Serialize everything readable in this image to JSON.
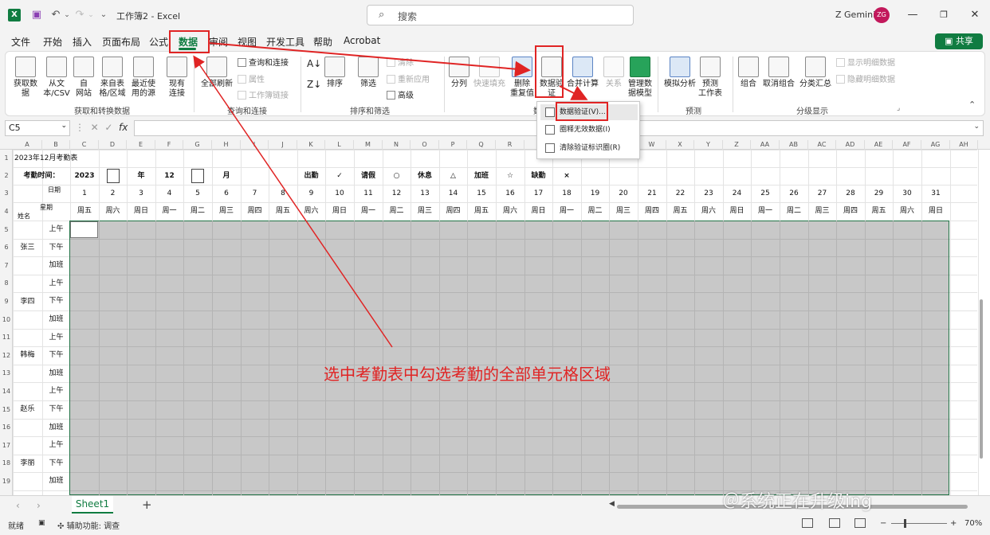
{
  "window": {
    "title": "工作簿2 - Excel",
    "search_placeholder": "搜索",
    "user_name": "Z Gemini",
    "avatar_initials": "ZG"
  },
  "menu": {
    "tabs": [
      "文件",
      "开始",
      "插入",
      "页面布局",
      "公式",
      "数据",
      "审阅",
      "视图",
      "开发工具",
      "帮助",
      "Acrobat"
    ],
    "active": "数据",
    "share": "共享"
  },
  "ribbon": {
    "get_data": "获取数\n据",
    "from_text_csv": "从文\n本/CSV",
    "from_web": "自\n网站",
    "from_table": "来自表\n格/区域",
    "recent_sources": "最近使\n用的源",
    "existing_connections": "现有\n连接",
    "group_get_transform": "获取和转换数据",
    "refresh_all": "全部刷新",
    "queries_connections": "查询和连接",
    "properties": "属性",
    "workbook_links": "工作簿链接",
    "group_queries": "查询和连接",
    "sort": "排序",
    "filter": "筛选",
    "clear": "清除",
    "reapply": "重新应用",
    "advanced": "高级",
    "group_sort_filter": "排序和筛选",
    "text_to_columns": "分列",
    "flash_fill": "快速填充",
    "remove_duplicates": "删除\n重复值",
    "data_validation": "数据验\n证",
    "consolidate": "合并计算",
    "relationships": "关系",
    "manage_data_model": "管理数\n据模型",
    "group_data_tools_partial": "数",
    "what_if": "模拟分析",
    "forecast_sheet": "预测\n工作表",
    "group_forecast": "预测",
    "group": "组合",
    "ungroup": "取消组合",
    "subtotal": "分类汇总",
    "show_detail": "显示明细数据",
    "hide_detail": "隐藏明细数据",
    "group_outline": "分级显示"
  },
  "dropdown": {
    "items": [
      "数据验证(V)...",
      "圈释无效数据(I)",
      "清除验证标识圈(R)"
    ]
  },
  "formula": {
    "namebox": "C5",
    "fx": "fx"
  },
  "sheet": {
    "columns": [
      "A",
      "B",
      "C",
      "D",
      "E",
      "F",
      "G",
      "H",
      "I",
      "J",
      "K",
      "L",
      "M",
      "N",
      "O",
      "P",
      "Q",
      "R",
      "S",
      "T",
      "U",
      "V",
      "W",
      "X",
      "Y",
      "Z",
      "AA",
      "AB",
      "AC",
      "AD",
      "AE",
      "AF",
      "AG",
      "AH"
    ],
    "rows": [
      "1",
      "2",
      "3",
      "4",
      "5",
      "6",
      "7",
      "8",
      "9",
      "10",
      "11",
      "12",
      "13",
      "14",
      "15",
      "16",
      "17",
      "18",
      "19"
    ],
    "title": "2023年12月考勤表",
    "attendance_label": "考勤时间：",
    "year": "2023",
    "year_unit": "年",
    "month": "12",
    "month_unit": "月",
    "legend": [
      {
        "label": "出勤",
        "symbol": "✓"
      },
      {
        "label": "请假",
        "symbol": "○"
      },
      {
        "label": "休息",
        "symbol": "△"
      },
      {
        "label": "加班",
        "symbol": "☆"
      },
      {
        "label": "缺勤",
        "symbol": "×"
      }
    ],
    "header_date": "日期",
    "header_weekday": "星期",
    "header_name": "姓名",
    "days": [
      "1",
      "2",
      "3",
      "4",
      "5",
      "6",
      "7",
      "8",
      "9",
      "10",
      "11",
      "12",
      "13",
      "14",
      "15",
      "16",
      "17",
      "18",
      "19",
      "20",
      "21",
      "22",
      "23",
      "24",
      "25",
      "26",
      "27",
      "28",
      "29",
      "30",
      "31"
    ],
    "weekdays": [
      "周五",
      "周六",
      "周日",
      "周一",
      "周二",
      "周三",
      "周四",
      "周五",
      "周六",
      "周日",
      "周一",
      "周二",
      "周三",
      "周四",
      "周五",
      "周六",
      "周日",
      "周一",
      "周二",
      "周三",
      "周四",
      "周五",
      "周六",
      "周日",
      "周一",
      "周二",
      "周三",
      "周四",
      "周五",
      "周六",
      "周日"
    ],
    "names": [
      "张三",
      "李四",
      "韩梅",
      "赵乐",
      "李丽"
    ],
    "shifts": [
      "上午",
      "下午",
      "加班"
    ]
  },
  "annotation": {
    "text": "选中考勤表中勾选考勤的全部单元格区域",
    "color": "#e02424"
  },
  "sheet_tabs": {
    "active": "Sheet1"
  },
  "status": {
    "ready": "就绪",
    "accessibility": "辅助功能: 调查",
    "zoom": "70%"
  },
  "watermark": "＠系统正在升级ing",
  "colors": {
    "excel_green": "#107c41",
    "selection_gray": "#c8c8c8",
    "annotation_red": "#e02424"
  }
}
